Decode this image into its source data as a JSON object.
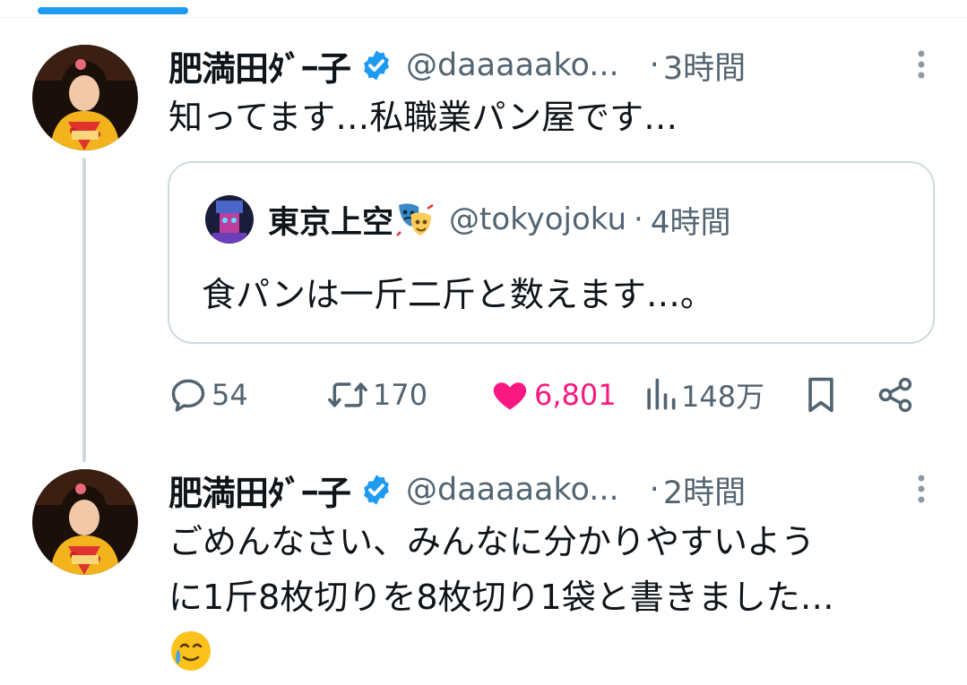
{
  "colors": {
    "accent": "#1d9bf0",
    "like": "#f91880",
    "muted": "#536471",
    "border": "#cfd9de"
  },
  "tweets": [
    {
      "author_name": "肥満田ﾀﾞｰ子",
      "verified": true,
      "handle": "@daaaaako...",
      "dot": "·",
      "time": "3時間",
      "text": "知ってます…私職業パン屋です…",
      "quote": {
        "author_name": "東京上空",
        "author_emoji": "performing-arts-emoji",
        "handle": "@tokyojoku",
        "dot": "·",
        "time": "4時間",
        "text": "食パンは一斤二斤と数えます…。"
      },
      "actions": {
        "replies": "54",
        "retweets": "170",
        "likes": "6,801",
        "liked": true,
        "views": "148万",
        "icons": [
          "reply-icon",
          "retweet-icon",
          "heart-icon",
          "views-icon",
          "bookmark-icon",
          "share-icon"
        ]
      }
    },
    {
      "author_name": "肥満田ﾀﾞｰ子",
      "verified": true,
      "handle": "@daaaaako...",
      "dot": "·",
      "time": "2時間",
      "text_lines": [
        "ごめんなさい、みんなに分かりやすいよう",
        "に1斤8枚切りを8枚切り1袋と書きました…"
      ],
      "trailing_emoji": "crying-smile-emoji"
    }
  ]
}
